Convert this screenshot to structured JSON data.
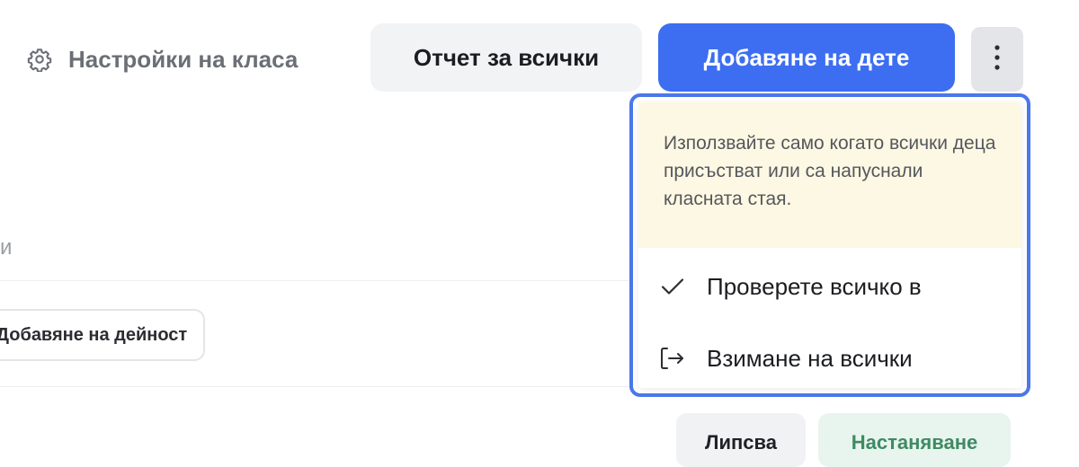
{
  "header": {
    "class_settings_label": "Настройки на класа",
    "report_all_label": "Отчет за всички",
    "add_child_label": "Добавяне на дете",
    "more_icon": "kebab-vertical-icon",
    "settings_icon": "gear-icon"
  },
  "background": {
    "partial_letter": "и",
    "add_activity_label": "Добавяне на дейност",
    "absent_chip_label": "Липсва",
    "settling_chip_label": "Настаняване"
  },
  "dropdown": {
    "notice_text": "Използвайте само когато всички деца присъстват или са напуснали класната стая.",
    "items": [
      {
        "label": "Проверете всичко в",
        "icon": "checkmark-icon"
      },
      {
        "label": "Взимане на всички",
        "icon": "sign-out-icon"
      }
    ]
  },
  "colors": {
    "primary": "#3d6ef2",
    "highlight_outline": "#4a77ea",
    "notice_bg": "#fdf8e3",
    "settling_text": "#3f8a64"
  }
}
